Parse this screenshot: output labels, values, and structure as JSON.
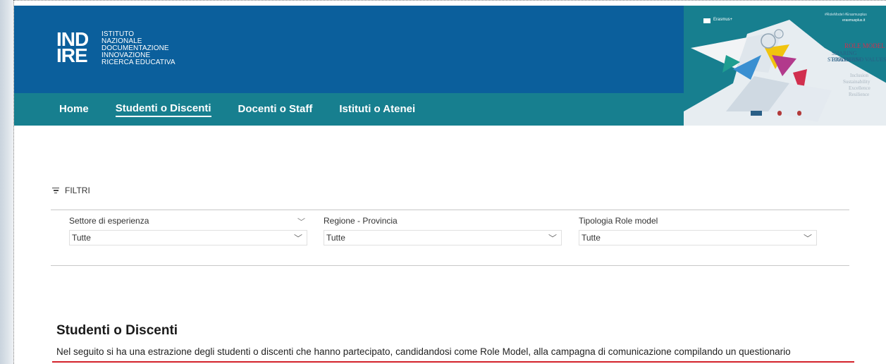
{
  "header": {
    "logo_mark_line1": "IND",
    "logo_mark_line2": "IRE",
    "logo_text": [
      "ISTITUTO",
      "NAZIONALE",
      "DOCUMENTAZIONE",
      "INNOVAZIONE",
      "RICERCA EDUCATIVA"
    ]
  },
  "nav": {
    "items": [
      {
        "label": "Home"
      },
      {
        "label": "Studenti o Discenti",
        "active": true
      },
      {
        "label": "Docenti o Staff"
      },
      {
        "label": "Istituti o Atenei"
      }
    ]
  },
  "promo": {
    "brand": "Erasmus+",
    "hashtags": "#RoleModel #Erasmusplus",
    "site": "erasmusplus.it",
    "title": "ROLE MODEL",
    "subtitle1": "SHARING ERASMUS+",
    "subtitle2": "STORIES AND VALUES",
    "values": [
      "Inclusion",
      "Sustainability",
      "Excellence",
      "Resilience"
    ]
  },
  "filters": {
    "heading": "FILTRI",
    "items": [
      {
        "label": "Settore di esperienza",
        "value": "Tutte"
      },
      {
        "label": "Regione - Provincia",
        "value": "Tutte"
      },
      {
        "label": "Tipologia Role model",
        "value": "Tutte"
      }
    ]
  },
  "section": {
    "title": "Studenti o Discenti",
    "description": "Nel seguito si ha una estrazione degli studenti o discenti che hanno partecipato, candidandosi come Role Model, alla campagna di comunicazione compilando un questionario"
  },
  "colors": {
    "banner_blue": "#0b5f9c",
    "nav_teal": "#177f8f",
    "accent_red": "#d3222a"
  }
}
